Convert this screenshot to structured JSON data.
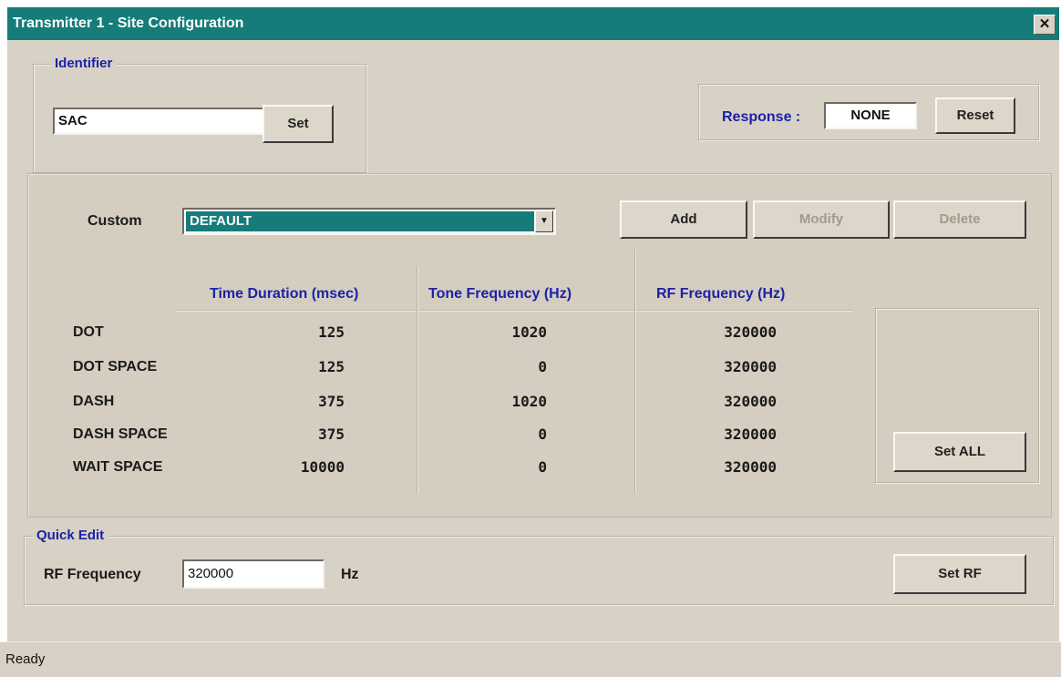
{
  "window": {
    "title": "Transmitter 1 - Site Configuration",
    "close_glyph": "✕"
  },
  "identifier": {
    "label": "Identifier",
    "value": "SAC",
    "set_label": "Set"
  },
  "response": {
    "label": "Response :",
    "value": "NONE",
    "reset_label": "Reset"
  },
  "custom": {
    "label": "Custom",
    "selected": "DEFAULT",
    "add_label": "Add",
    "modify_label": "Modify",
    "delete_label": "Delete",
    "set_all_label": "Set ALL"
  },
  "table": {
    "headers": [
      "Time Duration (msec)",
      "Tone Frequency (Hz)",
      "RF Frequency (Hz)"
    ],
    "rows": [
      {
        "name": "DOT",
        "time": "125",
        "tone": "1020",
        "rf": "320000"
      },
      {
        "name": "DOT SPACE",
        "time": "125",
        "tone": "0",
        "rf": "320000"
      },
      {
        "name": "DASH",
        "time": "375",
        "tone": "1020",
        "rf": "320000"
      },
      {
        "name": "DASH SPACE",
        "time": "375",
        "tone": "0",
        "rf": "320000"
      },
      {
        "name": "WAIT SPACE",
        "time": "10000",
        "tone": "0",
        "rf": "320000"
      }
    ]
  },
  "quick_edit": {
    "label": "Quick Edit",
    "rf_label": "RF Frequency",
    "rf_value": "320000",
    "unit": "Hz",
    "set_rf_label": "Set RF"
  },
  "status": {
    "text": "Ready"
  },
  "colors": {
    "title_bar": "#157c79",
    "selection": "#157c79",
    "group_label": "#1b22a8",
    "dialog_bg": "#d8d1c5"
  }
}
